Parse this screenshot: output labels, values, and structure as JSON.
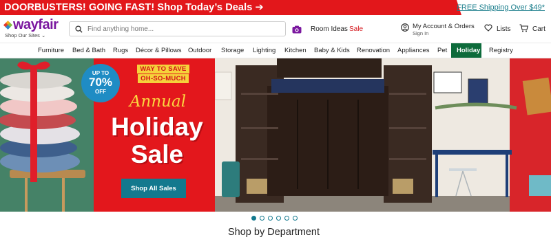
{
  "promo": {
    "text": "DOORBUSTERS! GOING FAST! Shop Today’s Deals ➔",
    "shipping": "FREE Shipping Over $49*",
    "color": "#e2171b"
  },
  "header": {
    "logo": "wayfair",
    "logo_sub": "Shop Our Sites ⌄",
    "search_placeholder": "Find anything home...",
    "room_ideas": "Room Ideas",
    "sale": "Sale",
    "account_title": "My Account & Orders",
    "account_sub": "Sign In",
    "lists": "Lists",
    "cart": "Cart",
    "brand_color": "#7b189f"
  },
  "nav": {
    "items": [
      {
        "label": "Furniture"
      },
      {
        "label": "Bed & Bath"
      },
      {
        "label": "Rugs"
      },
      {
        "label": "Décor & Pillows"
      },
      {
        "label": "Outdoor"
      },
      {
        "label": "Storage"
      },
      {
        "label": "Lighting"
      },
      {
        "label": "Kitchen"
      },
      {
        "label": "Baby & Kids"
      },
      {
        "label": "Renovation"
      },
      {
        "label": "Appliances"
      },
      {
        "label": "Pet"
      },
      {
        "label": "Holiday"
      },
      {
        "label": "Registry"
      }
    ],
    "active": "Holiday",
    "active_color": "#0d6b3b"
  },
  "hero": {
    "badge_line1": "UP TO",
    "badge_line2": "70%",
    "badge_line3": "OFF",
    "ribbon_line1": "WAY TO SAVE",
    "ribbon_line2": "OH-SO-MUCH",
    "annual": "Annual",
    "holiday": "Holiday",
    "sale": "Sale",
    "button": "Shop All Sales",
    "slides": 6,
    "active_slide": 1
  },
  "section": {
    "title": "Shop by Department"
  }
}
